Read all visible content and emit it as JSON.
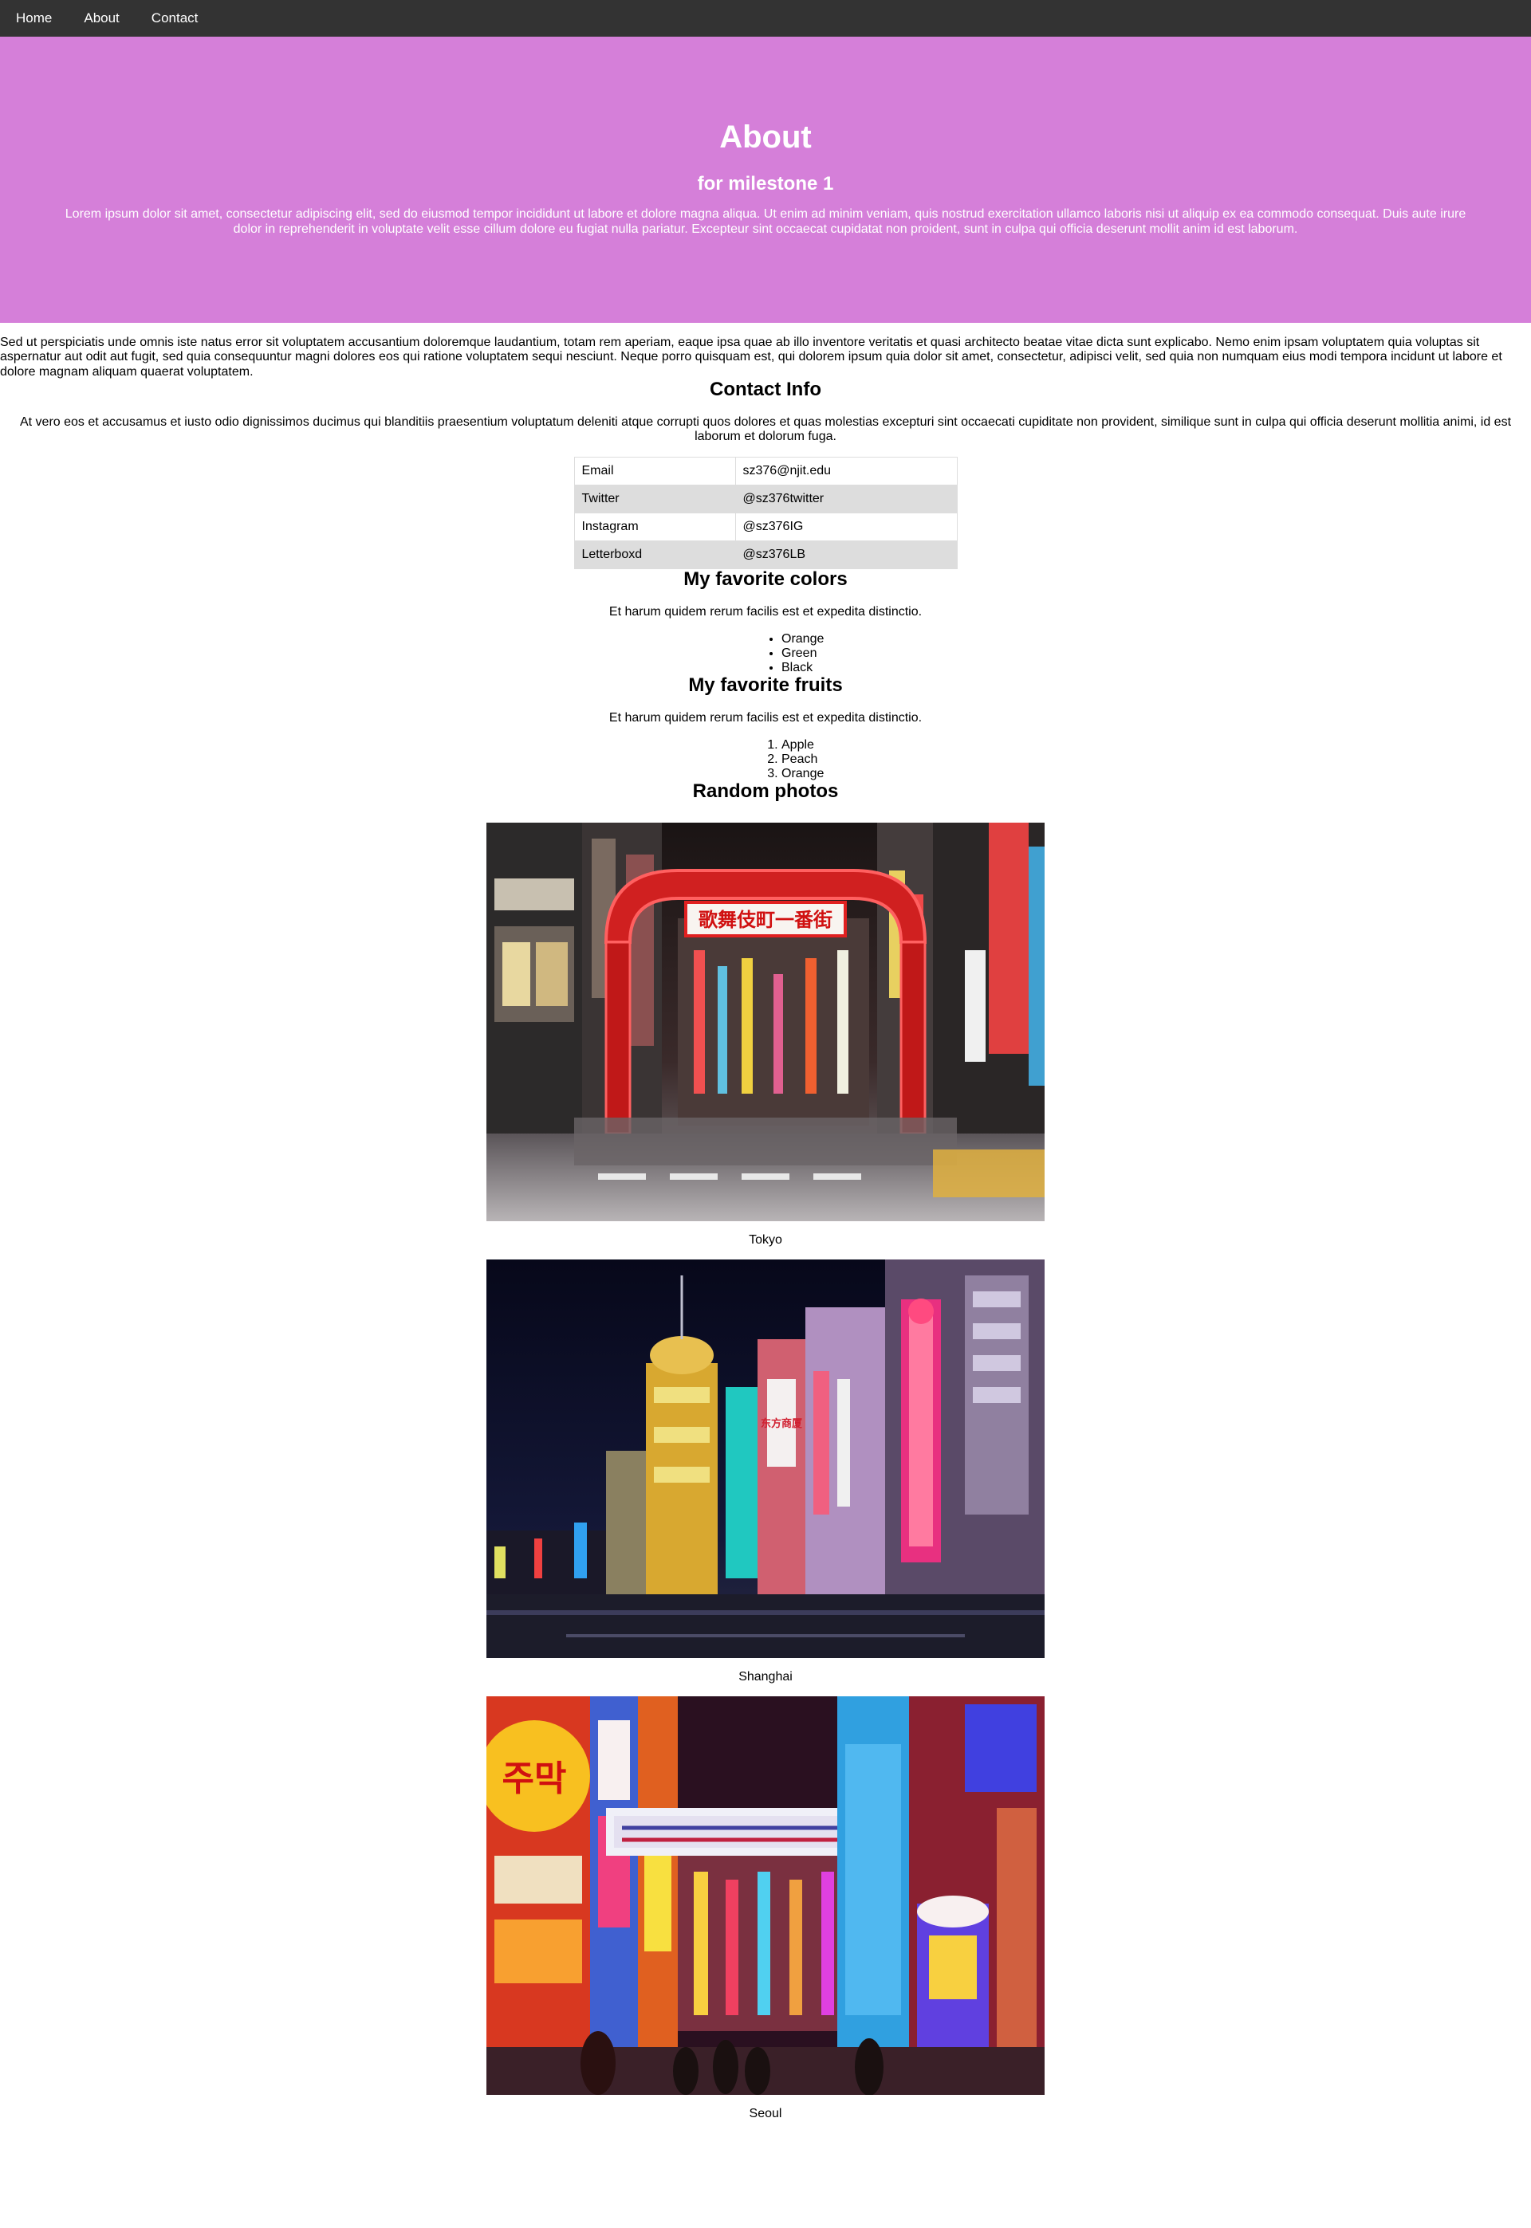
{
  "nav": {
    "items": [
      {
        "label": "Home"
      },
      {
        "label": "About"
      },
      {
        "label": "Contact"
      }
    ]
  },
  "hero": {
    "title": "About",
    "subtitle": "for milestone 1",
    "text": "Lorem ipsum dolor sit amet, consectetur adipiscing elit, sed do eiusmod tempor incididunt ut labore et dolore magna aliqua. Ut enim ad minim veniam, quis nostrud exercitation ullamco laboris nisi ut aliquip ex ea commodo consequat. Duis aute irure dolor in reprehenderit in voluptate velit esse cillum dolore eu fugiat nulla pariatur. Excepteur sint occaecat cupidatat non proident, sunt in culpa qui officia deserunt mollit anim id est laborum.",
    "color": "#d57fd9"
  },
  "intro": "Sed ut perspiciatis unde omnis iste natus error sit voluptatem accusantium doloremque laudantium, totam rem aperiam, eaque ipsa quae ab illo inventore veritatis et quasi architecto beatae vitae dicta sunt explicabo. Nemo enim ipsam voluptatem quia voluptas sit aspernatur aut odit aut fugit, sed quia consequuntur magni dolores eos qui ratione voluptatem sequi nesciunt. Neque porro quisquam est, qui dolorem ipsum quia dolor sit amet, consectetur, adipisci velit, sed quia non numquam eius modi tempora incidunt ut labore et dolore magnam aliquam quaerat voluptatem.",
  "contact": {
    "title": "Contact Info",
    "description": "At vero eos et accusamus et iusto odio dignissimos ducimus qui blanditiis praesentium voluptatum deleniti atque corrupti quos dolores et quas molestias excepturi sint occaecati cupiditate non provident, similique sunt in culpa qui officia deserunt mollitia animi, id est laborum et dolorum fuga.",
    "rows": [
      {
        "label": "Email",
        "value": "sz376@njit.edu"
      },
      {
        "label": "Twitter",
        "value": "@sz376twitter"
      },
      {
        "label": "Instagram",
        "value": "@sz376IG"
      },
      {
        "label": "Letterboxd",
        "value": "@sz376LB"
      }
    ]
  },
  "colors": {
    "title": "My favorite colors",
    "description": "Et harum quidem rerum facilis est et expedita distinctio.",
    "items": [
      "Orange",
      "Green",
      "Black"
    ]
  },
  "fruits": {
    "title": "My favorite fruits",
    "description": "Et harum quidem rerum facilis est et expedita distinctio.",
    "items": [
      "Apple",
      "Peach",
      "Orange"
    ]
  },
  "photos": {
    "title": "Random photos",
    "items": [
      {
        "caption": "Tokyo",
        "sign": "歌舞伎町一番街"
      },
      {
        "caption": "Shanghai",
        "sign": "东方商厦"
      },
      {
        "caption": "Seoul",
        "sign": "주막"
      }
    ]
  }
}
